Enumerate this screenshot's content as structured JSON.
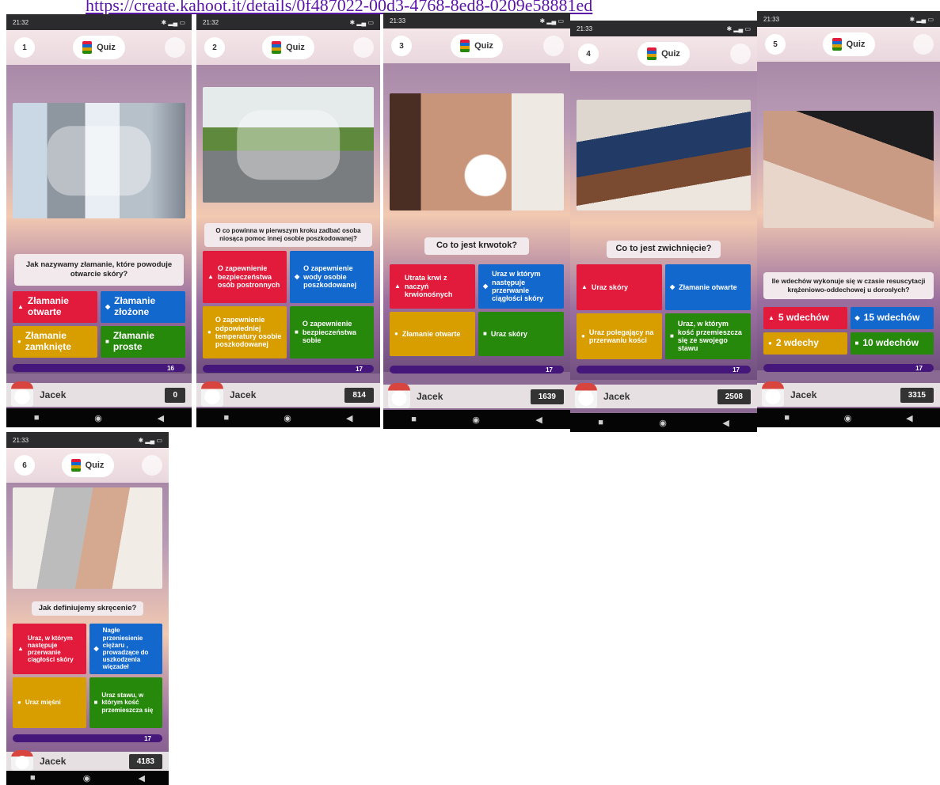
{
  "header_link": "https://create.kahoot.it/details/0f487022-00d3-4768-8ed8-0209e58881ed",
  "colors": {
    "red": "#e21b3c",
    "blue": "#1368ce",
    "yellow": "#d89e00",
    "green": "#26890c",
    "timer": "#46177a"
  },
  "screens": [
    {
      "time": "21:32",
      "qnum": "1",
      "app": "Quiz",
      "image": "leg-cast-photo",
      "question": "Jak nazywamy złamanie, które powoduje otwarcie skóry?",
      "answers": [
        {
          "text": "Złamanie otwarte",
          "shape": "triangle-icon",
          "symbol": "▲"
        },
        {
          "text": "Złamanie złożone",
          "shape": "diamond-icon",
          "symbol": "◆"
        },
        {
          "text": "Złamanie zamknięte",
          "shape": "circle-icon",
          "symbol": "●"
        },
        {
          "text": "Złamanie proste",
          "shape": "square-icon",
          "symbol": "■"
        }
      ],
      "timer": "16",
      "player": "Jacek",
      "score": "0"
    },
    {
      "time": "21:32",
      "qnum": "2",
      "app": "Quiz",
      "image": "accident-photo",
      "question": "O co powinna w pierwszym kroku zadbać osoba niosąca pomoc innej osobie poszkodowanej?",
      "answers": [
        {
          "text": "O zapewnienie bezpieczeństwa osób postronnych",
          "shape": "triangle-icon",
          "symbol": "▲"
        },
        {
          "text": "O zapewnienie wody osobie poszkodowanej",
          "shape": "diamond-icon",
          "symbol": "◆"
        },
        {
          "text": "O zapewnienie odpowiedniej temperatury osobie poszkodowanej",
          "shape": "circle-icon",
          "symbol": "●"
        },
        {
          "text": "O zapewnienie bezpieczeństwa sobie",
          "shape": "square-icon",
          "symbol": "■"
        }
      ],
      "timer": "17",
      "player": "Jacek",
      "score": "814"
    },
    {
      "time": "21:33",
      "qnum": "3",
      "app": "Quiz",
      "image": "nosebleed-photo",
      "question": "Co to jest krwotok?",
      "answers": [
        {
          "text": "Utrata krwi z naczyń krwionośnych",
          "shape": "triangle-icon",
          "symbol": "▲"
        },
        {
          "text": "Uraz w którym następuje przerwanie ciągłości skóry",
          "shape": "diamond-icon",
          "symbol": "◆"
        },
        {
          "text": "Złamanie otwarte",
          "shape": "circle-icon",
          "symbol": "●"
        },
        {
          "text": "Uraz skóry",
          "shape": "square-icon",
          "symbol": "■"
        }
      ],
      "timer": "17",
      "player": "Jacek",
      "score": "1639"
    },
    {
      "time": "21:33",
      "qnum": "4",
      "app": "Quiz",
      "image": "ankle-photo",
      "question": "Co to jest zwichnięcie?",
      "answers": [
        {
          "text": "Uraz skóry",
          "shape": "triangle-icon",
          "symbol": "▲"
        },
        {
          "text": "Złamanie otwarte",
          "shape": "diamond-icon",
          "symbol": "◆"
        },
        {
          "text": "Uraz polegający na przerwaniu kości",
          "shape": "circle-icon",
          "symbol": "●"
        },
        {
          "text": "Uraz, w którym kość przemieszcza się ze swojego stawu",
          "shape": "square-icon",
          "symbol": "■"
        }
      ],
      "timer": "17",
      "player": "Jacek",
      "score": "2508"
    },
    {
      "time": "21:33",
      "qnum": "5",
      "app": "Quiz",
      "image": "cpr-photo",
      "question": "Ile wdechów wykonuje się w czasie resuscytacji krążeniowo-oddechowej u dorosłych?",
      "answers": [
        {
          "text": "5 wdechów",
          "shape": "triangle-icon",
          "symbol": "▲"
        },
        {
          "text": "15 wdechów",
          "shape": "diamond-icon",
          "symbol": "◆"
        },
        {
          "text": "2 wdechy",
          "shape": "circle-icon",
          "symbol": "●"
        },
        {
          "text": "10 wdechów",
          "shape": "square-icon",
          "symbol": "■"
        }
      ],
      "timer": "17",
      "player": "Jacek",
      "score": "3315"
    },
    {
      "time": "21:33",
      "qnum": "6",
      "app": "Quiz",
      "image": "sprain-photo",
      "question": "Jak definiujemy skręcenie?",
      "answers": [
        {
          "text": "Uraz, w którym następuje przerwanie ciągłości skóry",
          "shape": "triangle-icon",
          "symbol": "▲"
        },
        {
          "text": "Nagłe przeniesienie ciężaru , prowadzące do uszkodzenia więzadeł",
          "shape": "diamond-icon",
          "symbol": "◆"
        },
        {
          "text": "Uraz mięśni",
          "shape": "circle-icon",
          "symbol": "●"
        },
        {
          "text": "Uraz stawu, w którym kość przemieszcza się",
          "shape": "square-icon",
          "symbol": "■"
        }
      ],
      "timer": "17",
      "player": "Jacek",
      "score": "4183"
    }
  ]
}
